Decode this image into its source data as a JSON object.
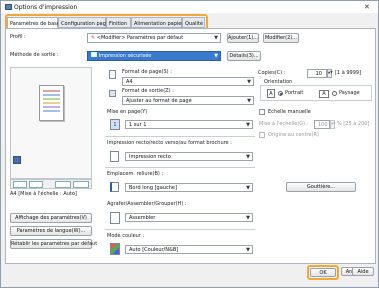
{
  "window": {
    "title": "Options d'impression",
    "close_glyph": "✕"
  },
  "tabs": [
    "Paramètres de base",
    "Configuration page",
    "Finition",
    "Alimentation papier",
    "Qualité"
  ],
  "profile": {
    "label": "Profil :",
    "value": "<Modifier> Paramètres par défaut",
    "add": "Ajouter(1)...",
    "edit": "Modifier(2)..."
  },
  "output": {
    "label": "Méthode de sortie :",
    "value": "Impression sécurisée",
    "details": "Détails(3)..."
  },
  "preview": {
    "caption": "A4 [Mise à l'échelle : Auto]"
  },
  "left_buttons": {
    "view_settings": "Affichage des paramètres(V)",
    "language": "Paramètres de langue(W)...",
    "restore": "Rétablir les paramètres par défaut"
  },
  "page_size": {
    "label": "Format de page(S) :",
    "value": "A4"
  },
  "output_size": {
    "label": "Format de sortie(Z) :",
    "value": "Ajuster au format de page"
  },
  "copies": {
    "label": "Copies(C) :",
    "value": "10",
    "range": "[1 à 9999]"
  },
  "orientation": {
    "label": "Orientation",
    "portrait": "Portrait",
    "landscape": "Paysage"
  },
  "layout": {
    "label": "Mise en page(Y)",
    "value": "1 sur 1"
  },
  "manual_scaling": {
    "label": "Echelle manuelle",
    "scale_label": "Mise à l'échelle(G) :",
    "scale_value": "100",
    "scale_range": "% [25 à 200]",
    "center_label": "Origine au centre(R)"
  },
  "duplex": {
    "label": "Impression recto/recto verso/au format brochure :",
    "value": "Impression recto"
  },
  "binding": {
    "label": "Emplacem. reliure(B) :",
    "value": "Bord long [gauche]"
  },
  "gutter": {
    "label": "Gouttière..."
  },
  "collate": {
    "label": "Agrafer/Assembler/Grouper(H) :",
    "value": "Assembler"
  },
  "color": {
    "label": "Mode couleur :",
    "value": "Auto [Couleur/N&B]"
  },
  "footer": {
    "ok": "OK",
    "cancel": "Annuler",
    "help": "Aide"
  }
}
